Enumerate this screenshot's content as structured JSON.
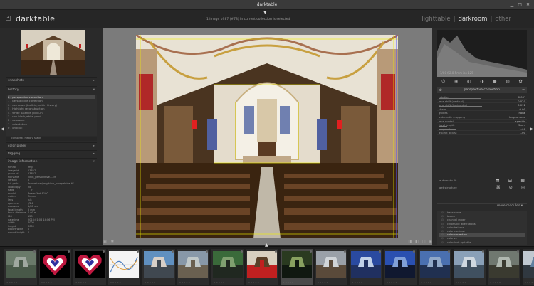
{
  "window": {
    "title": "darktable"
  },
  "header": {
    "logo": "darktable",
    "logo_sub": "",
    "collection_info": "1 image of 87 (#78) in current collection is selected",
    "views": [
      {
        "label": "lighttable",
        "active": false
      },
      {
        "label": "|",
        "active": false
      },
      {
        "label": "darkroom",
        "active": true
      },
      {
        "label": "|",
        "active": false
      },
      {
        "label": "other",
        "active": false
      }
    ]
  },
  "left": {
    "snapshots": "snapshots",
    "history_title": "history",
    "history_items": [
      "8 - perspective correction",
      "7 - perspective correction",
      "6 - demosaic (built-in, not in history)",
      "5 - highlight reconstruction",
      "4 - white balance (built-in)",
      "3 - raw black/white point",
      "2 - exposure",
      "1 - orientation",
      "0 - original"
    ],
    "compress": "compress history stack",
    "color_picker": "color picker",
    "tagging": "tagging",
    "image_info_title": "image information",
    "info": [
      {
        "k": "filmroll",
        "v": "img"
      },
      {
        "k": "image id",
        "v": "13627"
      },
      {
        "k": "group id",
        "v": "13627"
      },
      {
        "k": "filename",
        "v": "kirch_perspektive....tif"
      },
      {
        "k": "version",
        "v": "0"
      },
      {
        "k": "full path",
        "v": "/home/user/img/kirch_perspektive.tif"
      },
      {
        "k": "local copy",
        "v": "no"
      },
      {
        "k": "flags",
        "v": "___r___"
      },
      {
        "k": "model",
        "v": "PowerShot S100"
      },
      {
        "k": "maker",
        "v": "Canon"
      },
      {
        "k": "lens",
        "v": "n/a"
      },
      {
        "k": "aperture",
        "v": "f/2.8"
      },
      {
        "k": "exposure",
        "v": "1/80 sec"
      },
      {
        "k": "focal length",
        "v": "5 mm"
      },
      {
        "k": "focus distance",
        "v": "0.00 m"
      },
      {
        "k": "ISO",
        "v": "125"
      },
      {
        "k": "datetime",
        "v": "2016:01:06 14:06 PM"
      },
      {
        "k": "width",
        "v": "4000"
      },
      {
        "k": "height",
        "v": "3000"
      },
      {
        "k": "export width",
        "v": "0"
      },
      {
        "k": "export height",
        "v": "0"
      }
    ]
  },
  "right": {
    "histogram_label": "1/80 f/2.8 5mm iso 125",
    "module_title": "perspective correction",
    "sliders": [
      {
        "name": "rotation",
        "value": "0.00°",
        "level": 0.5
      },
      {
        "name": "lens shift (vertical)",
        "value": "0.020",
        "level": 0.52
      },
      {
        "name": "lens shift (horizontal)",
        "value": "0.012",
        "level": 0.51
      },
      {
        "name": "shear",
        "value": "0.00",
        "level": 0.5
      },
      {
        "name": "guides",
        "value": "none",
        "level": 0
      },
      {
        "name": "automatic cropping",
        "value": "largest area",
        "level": 0
      },
      {
        "name": "lens model",
        "value": "specific",
        "level": 0
      },
      {
        "name": "focal length",
        "value": "5mm",
        "level": 0.1
      },
      {
        "name": "crop factor",
        "value": "1.00",
        "level": 0.2
      },
      {
        "name": "aspect adjust",
        "value": "1.00",
        "level": 0.5
      }
    ],
    "automatic_fit": "automatic fit",
    "get_structure": "get structure",
    "more_modules": "more modules",
    "modules": [
      "base curve",
      "bloom",
      "channel mixer",
      "chromatic aberrations",
      "color balance",
      "color contrast",
      "color correction",
      "colorize",
      "color look up table"
    ]
  },
  "filmstrip": {
    "count": 16,
    "selected_index": 8,
    "stars": "☆☆☆☆☆"
  }
}
